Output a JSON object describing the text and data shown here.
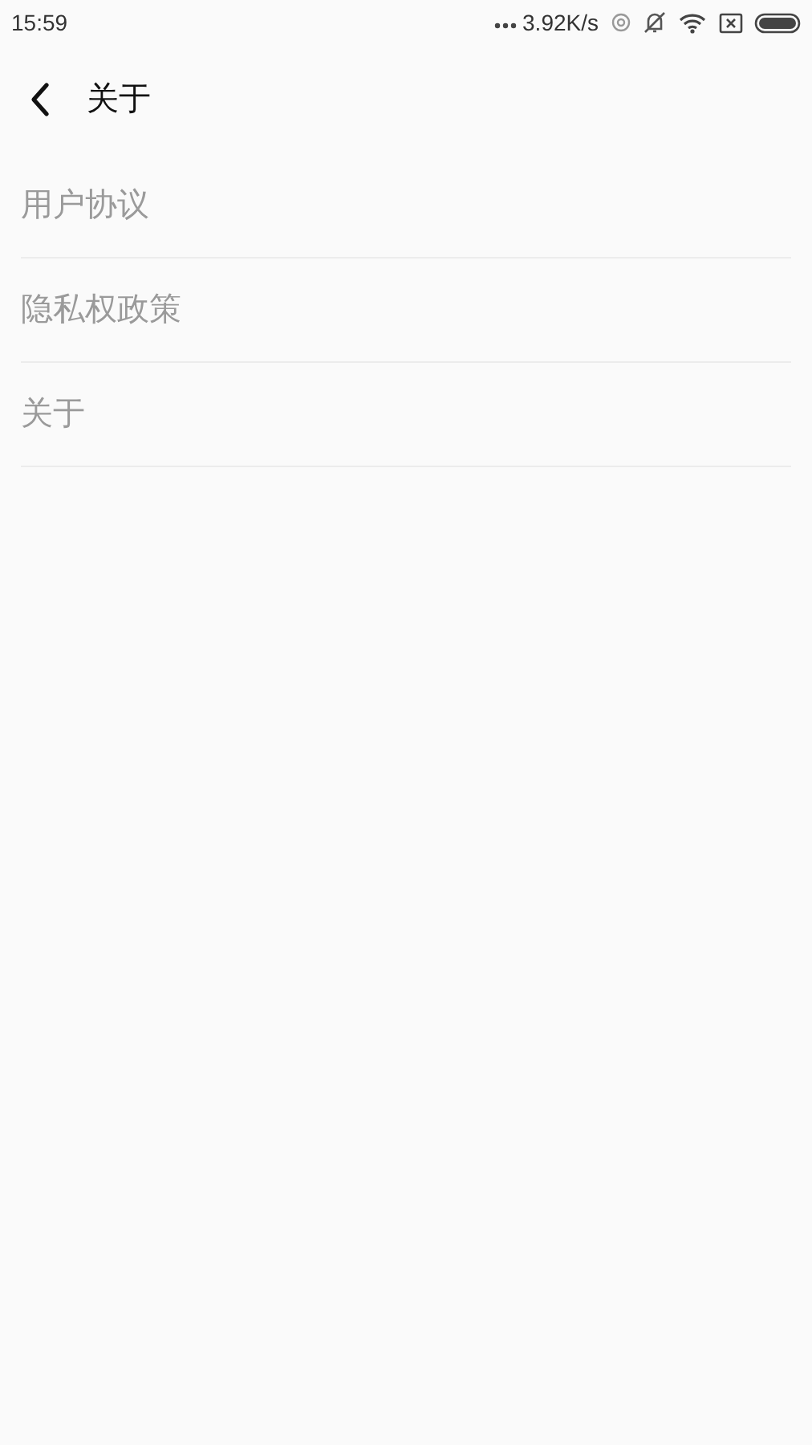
{
  "status_bar": {
    "time": "15:59",
    "network_speed": "3.92K/s"
  },
  "header": {
    "title": "关于"
  },
  "menu_items": [
    {
      "label": "用户协议"
    },
    {
      "label": "隐私权政策"
    },
    {
      "label": "关于"
    }
  ]
}
